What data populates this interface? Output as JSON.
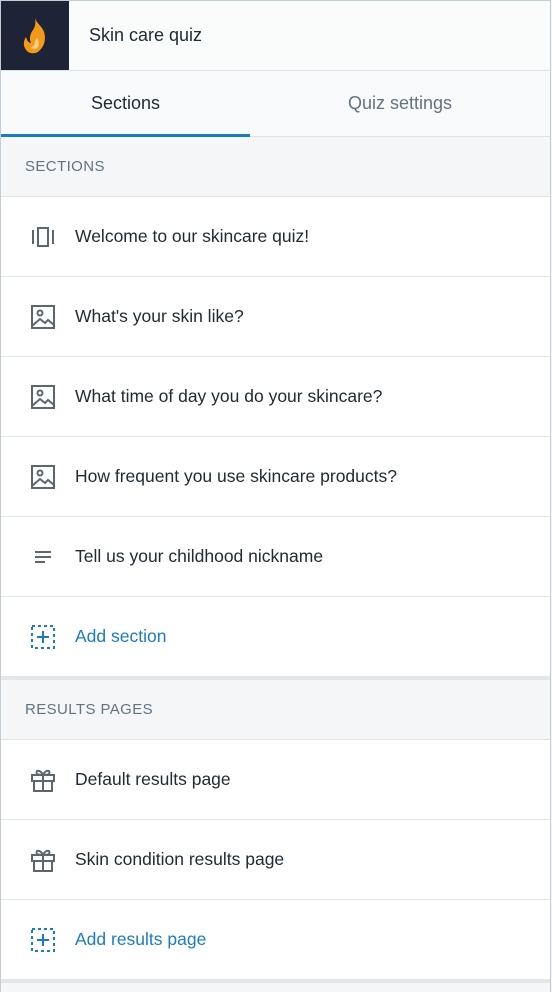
{
  "header": {
    "title": "Skin care quiz",
    "logo_icon": "flame-logo-icon"
  },
  "tabs": [
    {
      "label": "Sections",
      "active": true
    },
    {
      "label": "Quiz settings",
      "active": false
    }
  ],
  "sections": {
    "heading": "SECTIONS",
    "items": [
      {
        "label": "Welcome to our skincare quiz!",
        "icon": "slides-icon"
      },
      {
        "label": "What's your skin like?",
        "icon": "image-icon"
      },
      {
        "label": "What time of day you do your skincare?",
        "icon": "image-icon"
      },
      {
        "label": "How frequent you use skincare products?",
        "icon": "image-icon"
      },
      {
        "label": "Tell us your childhood nickname",
        "icon": "text-lines-icon"
      }
    ],
    "add_label": "Add section"
  },
  "results": {
    "heading": "RESULTS PAGES",
    "items": [
      {
        "label": "Default results page",
        "icon": "gift-icon"
      },
      {
        "label": "Skin condition results page",
        "icon": "gift-icon"
      }
    ],
    "add_label": "Add results page"
  },
  "colors": {
    "accent": "#1a7cc1",
    "logo_bg": "#1f2336",
    "flame": "#f49a1b"
  }
}
